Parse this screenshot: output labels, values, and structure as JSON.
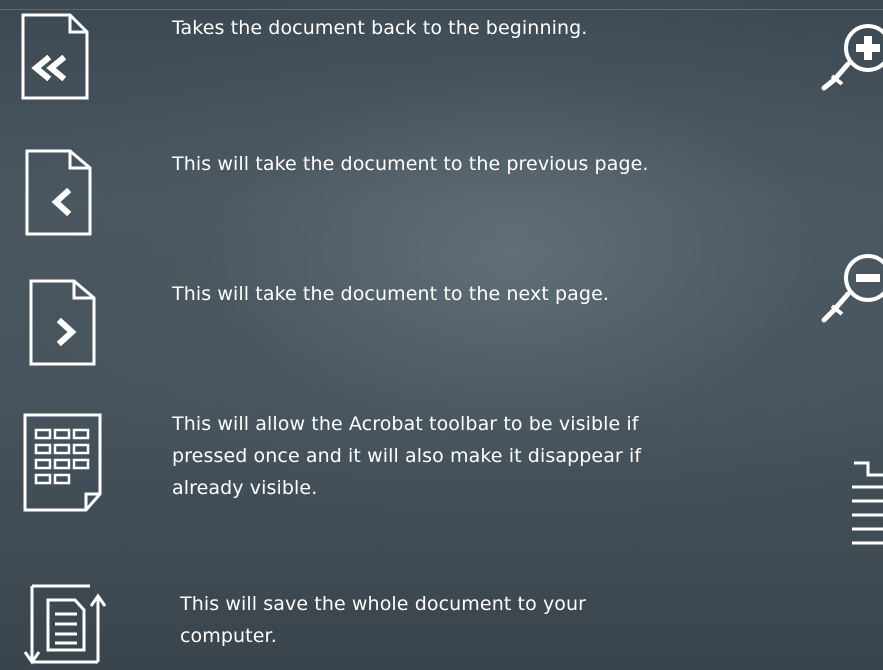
{
  "items": [
    {
      "icon": "first-page-icon",
      "description": "Takes the document back to the beginning."
    },
    {
      "icon": "previous-page-icon",
      "description": "This will take the document to the previous page."
    },
    {
      "icon": "next-page-icon",
      "description": "This will take the document to the next page."
    },
    {
      "icon": "toolbar-toggle-icon",
      "description_lines": [
        "This will allow the Acrobat toolbar to be visible if",
        "pressed once and it will also make it disappear if",
        "already visible."
      ]
    },
    {
      "icon": "save-document-icon",
      "description_lines": [
        "This will save the whole document to your",
        "computer."
      ]
    }
  ],
  "right_column": [
    {
      "icon": "zoom-in-icon"
    },
    {
      "icon": "zoom-out-icon"
    },
    {
      "icon": "text-view-icon"
    }
  ],
  "colors": {
    "icon_stroke": "#ffffff",
    "text": "#ffffff"
  }
}
